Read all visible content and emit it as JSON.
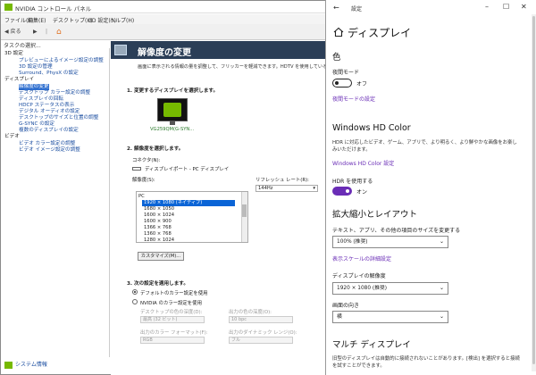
{
  "nvidia": {
    "title": "NVIDIA コントロール パネル",
    "menu": [
      "ファイル(F)",
      "編集(E)",
      "デスクトップ(K)",
      "3D 設定(3)",
      "ヘルプ(H)"
    ],
    "toolbar": {
      "back": "戻る",
      "forward": "→"
    },
    "tasks_label": "タスクの選択...",
    "tree": [
      {
        "label": "3D 設定",
        "cat": true
      },
      {
        "label": "プレビューによるイメージ設定の調整",
        "cat": false
      },
      {
        "label": "3D 設定の管理",
        "cat": false
      },
      {
        "label": "Surround、PhysX の設定",
        "cat": false
      },
      {
        "label": "ディスプレイ",
        "cat": true
      },
      {
        "label": "解像度の変更",
        "cat": false,
        "selected": true
      },
      {
        "label": "デスクトップ カラー設定の調整",
        "cat": false
      },
      {
        "label": "ディスプレイの回転",
        "cat": false
      },
      {
        "label": "HDCP ステータスの表示",
        "cat": false
      },
      {
        "label": "デジタル オーディオの設定",
        "cat": false
      },
      {
        "label": "デスクトップのサイズと位置の調整",
        "cat": false
      },
      {
        "label": "G-SYNC の設定",
        "cat": false
      },
      {
        "label": "複数のディスプレイの設定",
        "cat": false
      },
      {
        "label": "ビデオ",
        "cat": true
      },
      {
        "label": "ビデオ カラー設定の調整",
        "cat": false
      },
      {
        "label": "ビデオ イメージ設定の調整",
        "cat": false
      }
    ],
    "system_info": "システム情報",
    "main": {
      "title": "解像度の変更",
      "description": "画面に表示される情報の量を調整して、フリッカーを軽減できます。HDTV を使用している場合…",
      "step1": "1. 変更するディスプレイを選択します。",
      "monitor_label": "VG259QM(G-SYN...",
      "step2": "2. 解像度を選択します。",
      "connector_label": "コネクタ(N):",
      "connector_value": "ディスプレイポート - PC ディスプレイ",
      "resolution_label": "解像度(S):",
      "refresh_label": "リフレッシュ レート(R):",
      "refresh_value": "144Hz",
      "resolutions": [
        "PC",
        "1920 × 1080 (ネイティブ)",
        "1680 × 1050",
        "1600 × 1024",
        "1600 × 900",
        "1366 × 768",
        "1360 × 768",
        "1280 × 1024"
      ],
      "selected_resolution_index": 1,
      "customize_label": "カスタマイズ(M)...",
      "step3": "3. 次の設定を適用します。",
      "radio_default": "デフォルトのカラー設定を使用",
      "radio_nvidia": "NVIDIA のカラー設定を使用",
      "desktop_color_depth_label": "デスクトップの色の深度(D):",
      "desktop_color_depth_value": "最高 (32 ビット)",
      "output_color_depth_label": "出力の色の深度(O):",
      "output_color_depth_value": "10 bpc",
      "output_color_format_label": "出力のカラー フォーマット(F):",
      "output_color_format_value": "RGB",
      "output_dynamic_range_label": "出力のダイナミック レンジ(O):",
      "output_dynamic_range_value": "フル"
    }
  },
  "settings": {
    "window_title": "設定",
    "heading": "ディスプレイ",
    "color_section": "色",
    "night_light_label": "夜間モード",
    "night_light_state": "オフ",
    "night_light_link": "夜間モードの設定",
    "hd_color_heading": "Windows HD Color",
    "hd_color_desc": "HDR に対応したビデオ、ゲーム、アプリで、より明るく、より鮮やかな画像をお楽しみいただけます。",
    "hd_color_link": "Windows HD Color 設定",
    "hdr_label": "HDR を使用する",
    "hdr_state": "オン",
    "scale_heading": "拡大縮小とレイアウト",
    "text_size_label": "テキスト、アプリ、その他の項目のサイズを変更する",
    "text_size_value": "100% (推奨)",
    "advanced_scale_link": "表示スケールの詳細設定",
    "resolution_label": "ディスプレイの解像度",
    "resolution_value": "1920 × 1080 (推奨)",
    "orientation_label": "画面の向き",
    "orientation_value": "横",
    "multi_display_heading": "マルチ ディスプレイ",
    "multi_display_desc": "旧型のディスプレイは自動的に接続されないことがあります。[検出] を選択すると接続を試すことができます。"
  }
}
